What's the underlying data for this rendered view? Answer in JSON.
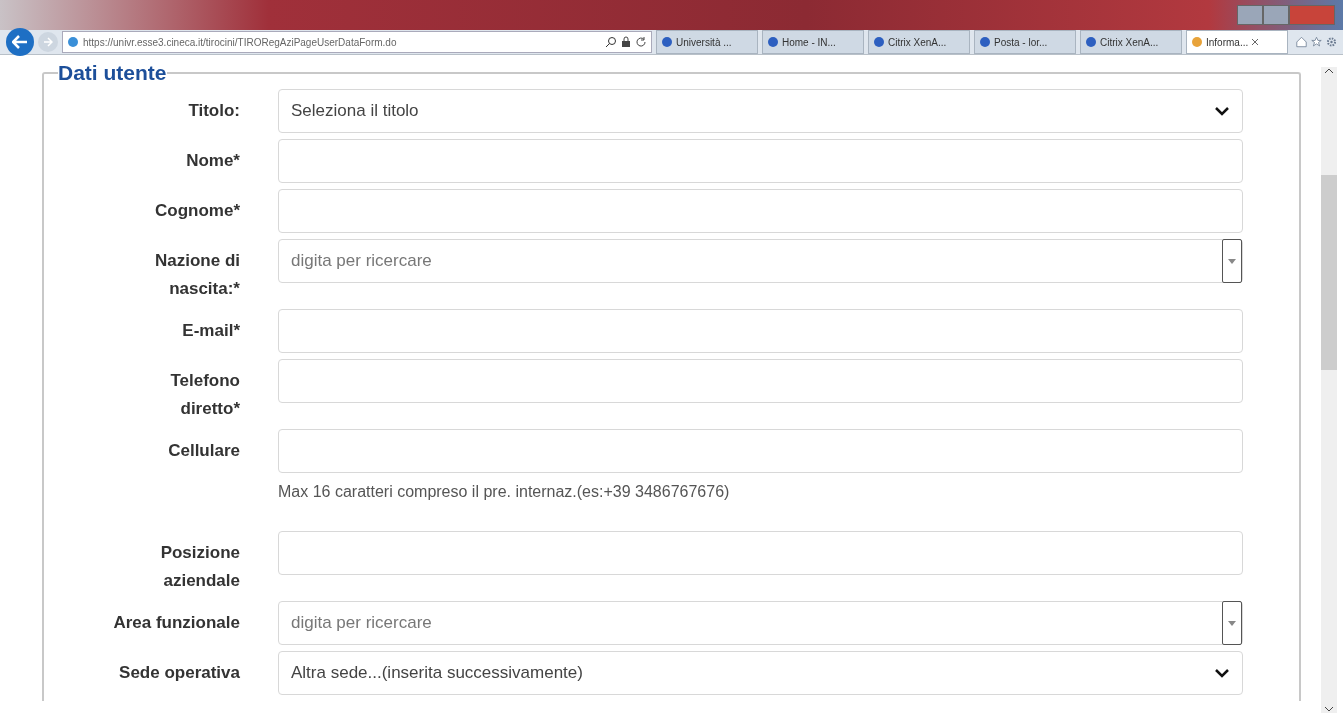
{
  "browser": {
    "url": "https://univr.esse3.cineca.it/tirocini/TIRORegAziPageUserDataForm.do",
    "tabs": [
      {
        "label": "Università ...",
        "selected": false
      },
      {
        "label": "Home - IN...",
        "selected": false
      },
      {
        "label": "Citrix XenA...",
        "selected": false
      },
      {
        "label": "Posta - lor...",
        "selected": false
      },
      {
        "label": "Citrix XenA...",
        "selected": false
      },
      {
        "label": "Informa...",
        "selected": true
      }
    ]
  },
  "form": {
    "legend": "Dati utente",
    "fields": [
      {
        "label": "Titolo:",
        "kind": "select",
        "value": "Seleziona il titolo"
      },
      {
        "label": "Nome*",
        "kind": "text"
      },
      {
        "label": "Cognome*",
        "kind": "text"
      },
      {
        "label": "Nazione di nascita:*",
        "kind": "combo",
        "placeholder": "digita per ricercare"
      },
      {
        "label": "E-mail*",
        "kind": "text"
      },
      {
        "label": "Telefono diretto*",
        "kind": "text"
      },
      {
        "label": "Cellulare",
        "kind": "text",
        "hint": "Max 16 caratteri compreso il pre. internaz.(es:+39 3486767676)"
      },
      {
        "label": "Posizione aziendale",
        "kind": "text"
      },
      {
        "label": "Area funzionale",
        "kind": "combo",
        "placeholder": "digita per ricercare"
      },
      {
        "label": "Sede operativa",
        "kind": "select",
        "value": "Altra sede...(inserita successivamente)"
      }
    ]
  }
}
